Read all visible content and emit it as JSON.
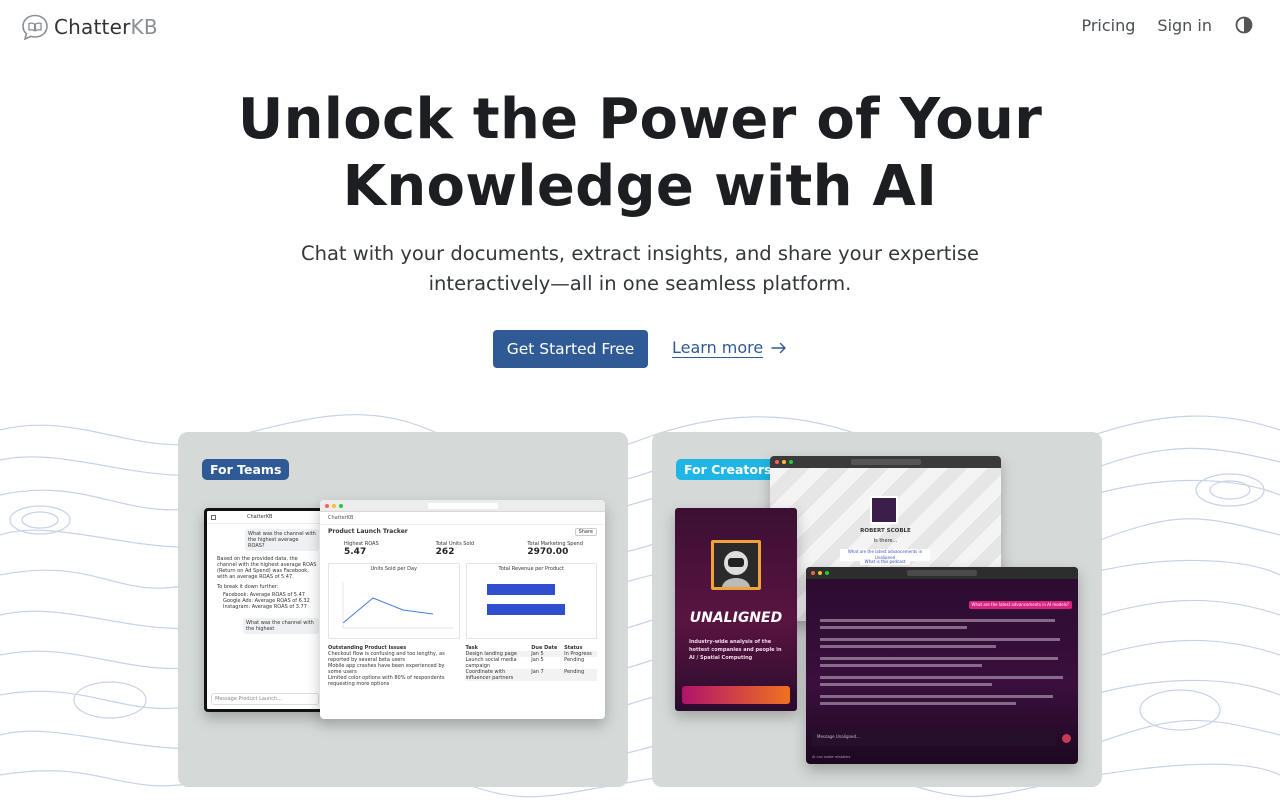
{
  "header": {
    "logo_main": "Chatter",
    "logo_accent": "KB",
    "nav": [
      {
        "label": "Pricing"
      },
      {
        "label": "Sign in"
      }
    ],
    "theme_toggle_icon": "contrast-icon"
  },
  "hero": {
    "title_line1": "Unlock the Power of Your",
    "title_line2": "Knowledge with AI",
    "subtitle_line1": "Chat with your documents, extract insights, and share your expertise",
    "subtitle_line2": "interactively—all in one seamless platform.",
    "primary_cta": "Get Started Free",
    "secondary_cta": "Learn more",
    "secondary_cta_icon": "arrow-right-icon"
  },
  "showcase": {
    "teams": {
      "badge": "For Teams",
      "phone_chat": {
        "user_msg": "What was the channel with the highest average ROAS?",
        "answer_1": "Based on the provided data, the channel with the highest average ROAS (Return on Ad Spend) was Facebook, with an average ROAS of 5.47.",
        "breakdown_title": "To break it down further:",
        "breakdown": [
          "Facebook: Average ROAS of 5.47",
          "Google Ads: Average ROAS of 6.32",
          "Instagram: Average ROAS of 3.77"
        ],
        "followup_msg": "What was the channel with the highest",
        "input_placeholder": "Message Product Launch..."
      },
      "tracker": {
        "title": "Product Launch Tracker",
        "share_label": "Share",
        "stats": [
          {
            "label": "Highest ROAS",
            "value": "5.47"
          },
          {
            "label": "Total Units Sold",
            "value": "262"
          },
          {
            "label": "Total Marketing Spend",
            "value": "2970.00"
          }
        ],
        "line_chart_title": "Units Sold per Day",
        "bar_chart_title": "Total Revenue per Product",
        "issues_title": "Outstanding Product Issues",
        "issues": [
          "Checkout flow is confusing and too lengthy, as reported by several beta users",
          "Mobile app crashes have been experienced by some users",
          "Limited color options with 80% of respondents requesting more options"
        ],
        "task_headers": [
          "Task",
          "Due Date",
          "Status"
        ],
        "tasks": [
          [
            "Design landing page",
            "Jan 5",
            "In Progress"
          ],
          [
            "Launch social media campaign",
            "Jan 5",
            "Pending"
          ],
          [
            "Coordinate with influencer partners",
            "Jan 7",
            "Pending"
          ]
        ]
      }
    },
    "creators": {
      "badge": "For Creators",
      "profile_name": "ROBERT SCOBLE",
      "profile_status": "Is there...",
      "profile_question": "What are the latest advancements in Unaligned",
      "profile_button": "What is this podcast",
      "promo_title": "UNALIGNED",
      "promo_text": "Industry-wide analysis of the hottest companies and people in AI / Spatial Computing",
      "dark_user_msg": "What are the latest advancements in AI models?",
      "dark_input_placeholder": "Message Unaligned...",
      "dark_footer": "AI can make mistakes"
    }
  }
}
